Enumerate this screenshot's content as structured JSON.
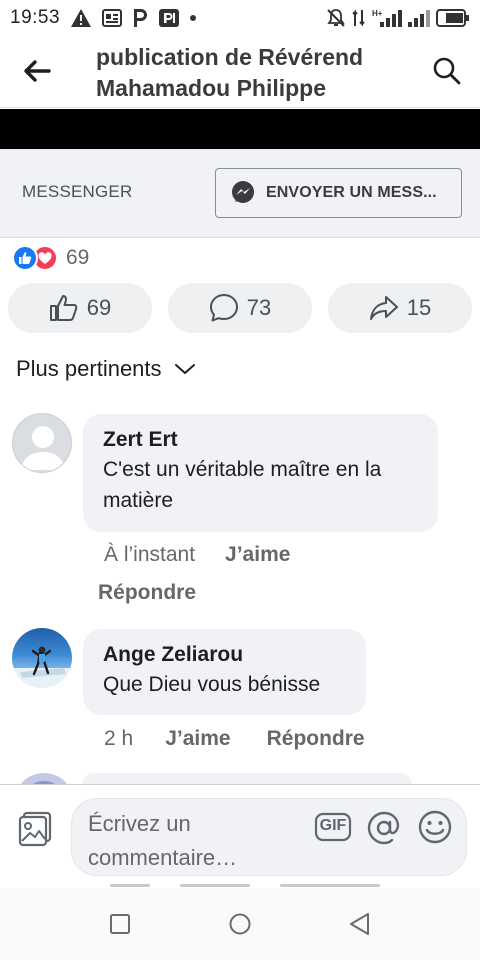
{
  "status_bar": {
    "time": "19:53",
    "icons_left": [
      "warning-icon",
      "news-icon",
      "parking-icon",
      "parking-app-icon",
      "dot-icon"
    ],
    "icons_right": [
      "mute-icon",
      "data-arrows-icon",
      "signal-h-icon",
      "signal-icon",
      "battery-icon"
    ]
  },
  "header": {
    "title": "publication de Révérend Mahamadou Philippe",
    "back_icon": "arrow-left-icon",
    "search_icon": "search-icon"
  },
  "messenger": {
    "label": "MESSENGER",
    "button_label": "ENVOYER UN MESS..."
  },
  "reactions": {
    "count": "69",
    "types": [
      "like",
      "love"
    ]
  },
  "actions": {
    "like_count": "69",
    "comment_count": "73",
    "share_count": "15"
  },
  "sort": {
    "label": "Plus pertinents"
  },
  "comments": [
    {
      "author": "Zert Ert",
      "text": "C'est un véritable maître en la matière",
      "time": "À l’instant",
      "like_label": "J’aime",
      "reply_label": "Répondre"
    },
    {
      "author": "Ange Zeliarou",
      "text": "Que Dieu vous bénisse",
      "time": "2 h",
      "like_label": "J’aime",
      "reply_label": "Répondre"
    }
  ],
  "composer": {
    "placeholder": "Écrivez un commentaire…",
    "gif_label": "GIF"
  },
  "colors": {
    "accent": "#1877f2",
    "love": "#f33e58",
    "bubble": "#f0f2f5",
    "secondary_text": "#65676b"
  }
}
